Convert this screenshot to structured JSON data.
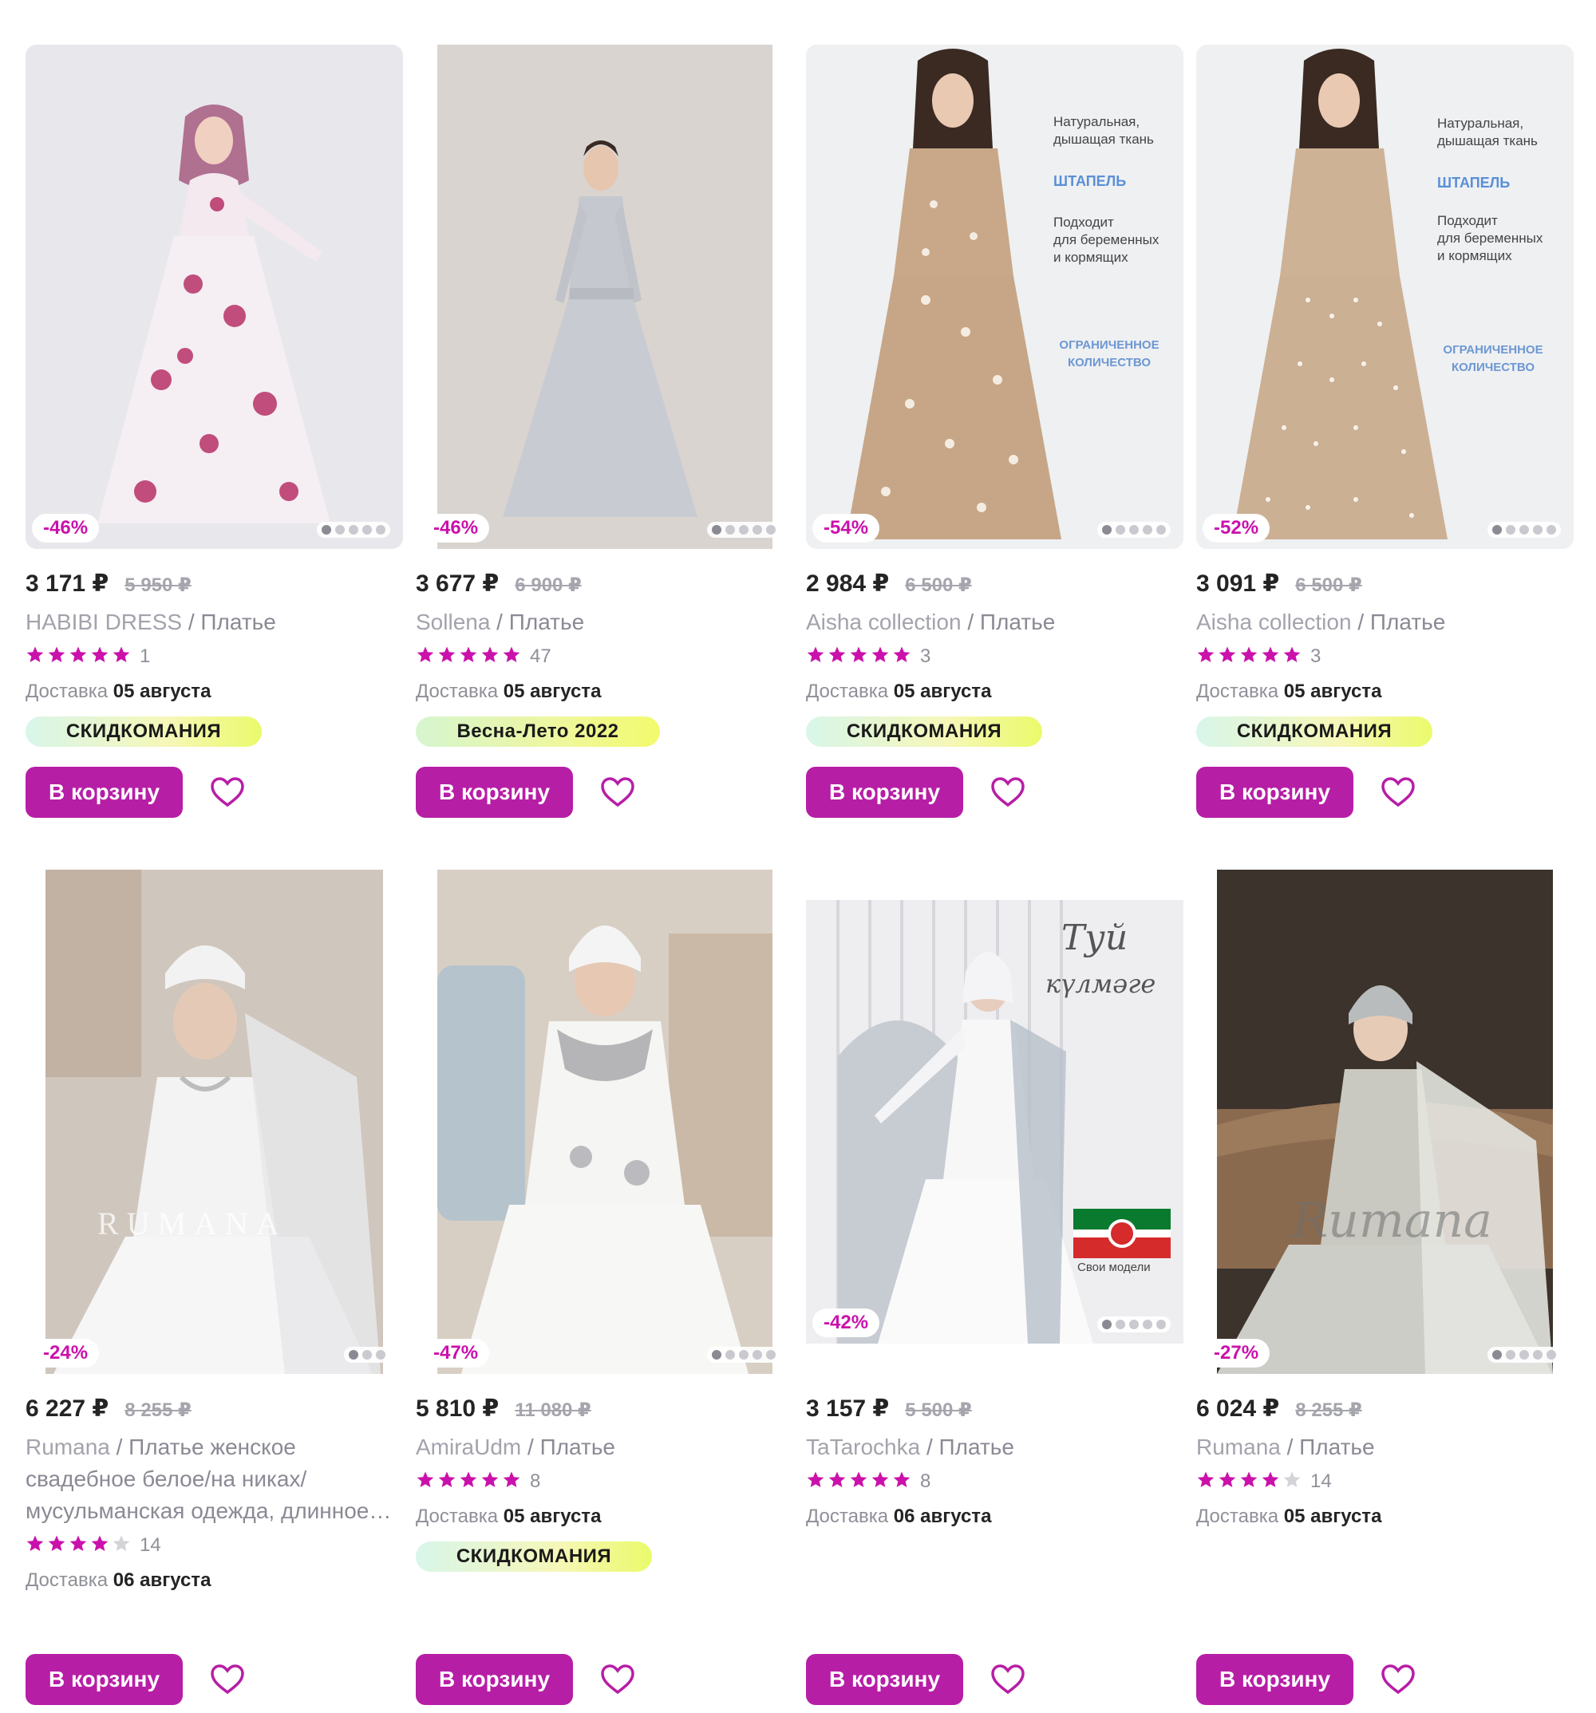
{
  "colors": {
    "accent": "#b71ea6",
    "discount": "#cb11ab",
    "star": "#cb11ab",
    "star_empty": "#d4d4d8"
  },
  "delivery_label": "Доставка",
  "cart_label": "В корзину",
  "products": [
    {
      "discount": "-46%",
      "price": "3 171 ₽",
      "old_price": "5 950 ₽",
      "brand": "HABIBI DRESS",
      "name": " / Платье",
      "stars": 5,
      "reviews": "1",
      "delivery_date": "05 августа",
      "badge": "СКИДКОМАНИЯ"
    },
    {
      "discount": "-46%",
      "price": "3 677 ₽",
      "old_price": "6 900 ₽",
      "brand": "Sollena",
      "name": " / Платье",
      "stars": 5,
      "reviews": "47",
      "delivery_date": "05 августа",
      "badge": "Весна-Лето 2022"
    },
    {
      "discount": "-54%",
      "price": "2 984 ₽",
      "old_price": "6 500 ₽",
      "brand": "Aisha collection",
      "name": " / Платье",
      "stars": 5,
      "reviews": "3",
      "delivery_date": "05 августа",
      "badge": "СКИДКОМАНИЯ",
      "overlay": {
        "line1": "Натуральная,",
        "line2": "дышащая ткань",
        "fabric": "ШТАПЕЛЬ",
        "fit1": "Подходит",
        "fit2": "для беременных",
        "fit3": "и кормящих",
        "limit1": "ОГРАНИЧЕННОЕ",
        "limit2": "КОЛИЧЕСТВО"
      }
    },
    {
      "discount": "-52%",
      "price": "3 091 ₽",
      "old_price": "6 500 ₽",
      "brand": "Aisha collection",
      "name": " / Платье",
      "stars": 5,
      "reviews": "3",
      "delivery_date": "05 августа",
      "badge": "СКИДКОМАНИЯ",
      "overlay": {
        "line1": "Натуральная,",
        "line2": "дышащая ткань",
        "fabric": "ШТАПЕЛЬ",
        "fit1": "Подходит",
        "fit2": "для беременных",
        "fit3": "и кормящих",
        "limit1": "ОГРАНИЧЕННОЕ",
        "limit2": "КОЛИЧЕСТВО"
      }
    },
    {
      "discount": "-24%",
      "price": "6 227 ₽",
      "old_price": "8 255 ₽",
      "brand": "Rumana",
      "name": " / Платье женское свадебное белое/на никах/мусульманская одежда, длинное…",
      "stars": 4,
      "reviews": "14",
      "delivery_date": "06 августа",
      "watermark": "RUMANA"
    },
    {
      "discount": "-47%",
      "price": "5 810 ₽",
      "old_price": "11 080 ₽",
      "brand": "AmiraUdm",
      "name": " / Платье",
      "stars": 5,
      "reviews": "8",
      "delivery_date": "05 августа",
      "badge": "СКИДКОМАНИЯ"
    },
    {
      "discount": "-42%",
      "price": "3 157 ₽",
      "old_price": "5 500 ₽",
      "brand": "TaTarochka",
      "name": " / Платье",
      "stars": 5,
      "reviews": "8",
      "delivery_date": "06 августа",
      "overlay": {
        "script1": "Туй",
        "script2": "күлмәге",
        "own": "Свои модели"
      }
    },
    {
      "discount": "-27%",
      "price": "6 024 ₽",
      "old_price": "8 255 ₽",
      "brand": "Rumana",
      "name": " / Платье",
      "stars": 4,
      "reviews": "14",
      "delivery_date": "05 августа",
      "watermark": "Rumana"
    }
  ]
}
